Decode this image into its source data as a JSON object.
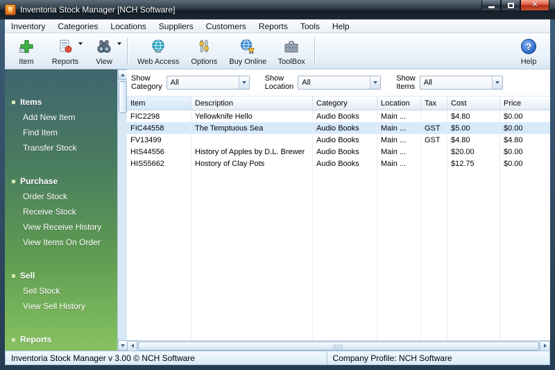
{
  "titlebar": {
    "title": "Inventoria Stock Manager [NCH Software]"
  },
  "menu": {
    "items": [
      "Inventory",
      "Categories",
      "Locations",
      "Suppliers",
      "Customers",
      "Reports",
      "Tools",
      "Help"
    ]
  },
  "toolbar": {
    "buttons": [
      {
        "label": "Item",
        "icon": "add-item-icon",
        "dropdown": false
      },
      {
        "label": "Reports",
        "icon": "reports-icon",
        "dropdown": true
      },
      {
        "label": "View",
        "icon": "binoculars-icon",
        "dropdown": true
      },
      {
        "label": "Web Access",
        "icon": "globe-icon",
        "dropdown": false
      },
      {
        "label": "Options",
        "icon": "sliders-icon",
        "dropdown": false
      },
      {
        "label": "Buy Online",
        "icon": "globe-cart-icon",
        "dropdown": false
      },
      {
        "label": "ToolBox",
        "icon": "briefcase-icon",
        "dropdown": false
      },
      {
        "label": "Help",
        "icon": "help-icon",
        "dropdown": false
      }
    ]
  },
  "sidebar": {
    "sections": [
      {
        "title": "Items",
        "items": [
          "Add New Item",
          "Find Item",
          "Transfer Stock"
        ]
      },
      {
        "title": "Purchase",
        "items": [
          "Order Stock",
          "Receive Stock",
          "View Receive History",
          "View Items On Order"
        ]
      },
      {
        "title": "Sell",
        "items": [
          "Sell Stock",
          "View Sell History"
        ]
      },
      {
        "title": "Reports",
        "items": []
      }
    ]
  },
  "filters": {
    "category": {
      "label1": "Show",
      "label2": "Category",
      "value": "All"
    },
    "location": {
      "label1": "Show",
      "label2": "Location",
      "value": "All"
    },
    "items": {
      "label1": "Show",
      "label2": "Items",
      "value": "All"
    }
  },
  "table": {
    "columns": [
      "Item",
      "Description",
      "Category",
      "Location",
      "Tax",
      "Cost",
      "Price"
    ],
    "sorted_column": "Item",
    "selected_row_index": 1,
    "rows": [
      [
        "FIC2298",
        "Yellowknife Hello",
        "Audio Books",
        "Main ...",
        "",
        "$4.80",
        "$0.00"
      ],
      [
        "FIC44558",
        "The Temptuous Sea",
        "Audio Books",
        "Main ...",
        "GST",
        "$5.00",
        "$0.00"
      ],
      [
        "FV13499",
        "",
        "Audio Books",
        "Main ...",
        "GST",
        "$4.80",
        "$4.80"
      ],
      [
        "HIS44556",
        "History of Apples by D.L. Brewer",
        "Audio Books",
        "Main ...",
        "",
        "$20.00",
        "$0.00"
      ],
      [
        "HIS55662",
        "Hostory of Clay Pots",
        "Audio Books",
        "Main ...",
        "",
        "$12.75",
        "$0.00"
      ]
    ]
  },
  "statusbar": {
    "left": "Inventoria Stock Manager v 3.00 © NCH Software",
    "right": "Company Profile: NCH Software"
  },
  "colors": {
    "selection_blue": "#d8eafa",
    "sidebar_top_green": "#40666f",
    "sidebar_bottom_green": "#87c261",
    "close_button_red": "#cc3a22",
    "help_blue": "#2f6fd0",
    "frame_blue": "#2e4burnt"
  }
}
